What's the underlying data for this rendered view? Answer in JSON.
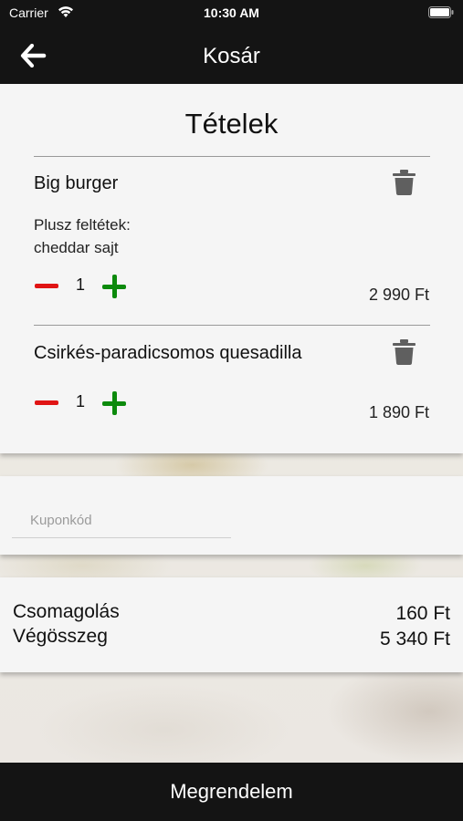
{
  "status_bar": {
    "carrier": "Carrier",
    "time": "10:30 AM"
  },
  "nav": {
    "title": "Kosár",
    "back_icon": "arrow-left-icon"
  },
  "cart": {
    "heading": "Tételek",
    "items": [
      {
        "name": "Big burger",
        "extras_label": "Plusz feltétek:",
        "extras_value": "cheddar sajt",
        "quantity": "1",
        "price": "2 990 Ft"
      },
      {
        "name": "Csirkés-paradicsomos quesadilla",
        "quantity": "1",
        "price": "1 890 Ft"
      }
    ]
  },
  "coupon": {
    "placeholder": "Kuponkód",
    "value": ""
  },
  "totals": {
    "packaging_label": "Csomagolás",
    "packaging_value": "160 Ft",
    "total_label": "Végösszeg",
    "total_value": "5 340 Ft"
  },
  "order_button": {
    "label": "Megrendelem"
  },
  "colors": {
    "bar": "#141414",
    "minus": "#e01414",
    "plus": "#0c8a0c",
    "card": "#f5f5f5"
  }
}
